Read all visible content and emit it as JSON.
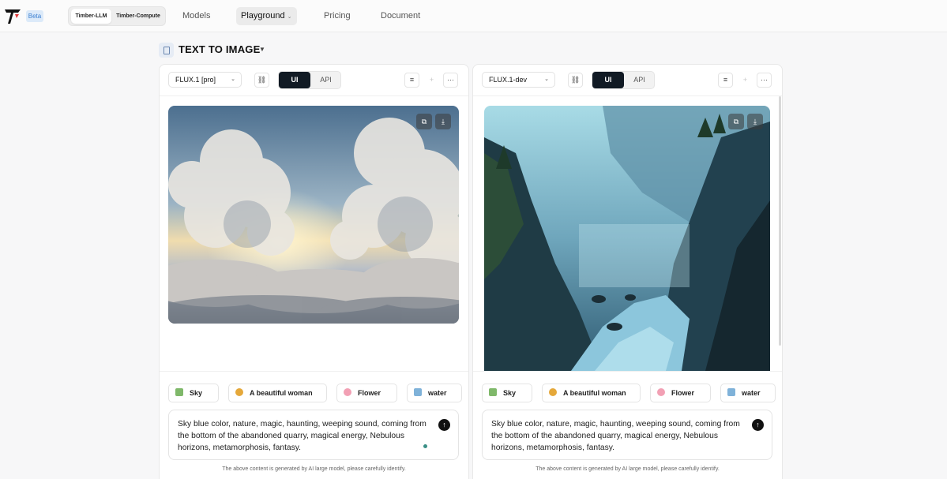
{
  "brand": {
    "beta_label": "Beta",
    "logo_icon": "timber-logo-icon"
  },
  "switcher": {
    "items": [
      "Timber-LLM",
      "Timber-Compute"
    ]
  },
  "nav": {
    "items": [
      "Models",
      "Playground",
      "Pricing",
      "Document"
    ]
  },
  "section": {
    "title": "TEXT TO IMAGE"
  },
  "panels": [
    {
      "model": "FLUX.1 [pro]",
      "mode": {
        "ui": "UI",
        "api": "API"
      },
      "image": "cloud sky above sea of clouds",
      "chips": [
        "Sky",
        "A beautiful woman",
        "Flower",
        "water"
      ],
      "prompt": "Sky blue color, nature, magic, haunting, weeping sound, coming from the bottom of the abandoned quarry, magical energy, Nebulous horizons, metamorphosis, fantasy.",
      "disclaimer": "The above content is generated by AI large model, please carefully identify."
    },
    {
      "model": "FLUX.1-dev",
      "mode": {
        "ui": "UI",
        "api": "API"
      },
      "image": "misty blue canyon river",
      "chips": [
        "Sky",
        "A beautiful woman",
        "Flower",
        "water"
      ],
      "prompt": "Sky blue color, nature, magic, haunting, weeping sound, coming from the bottom of the abandoned quarry, magical energy, Nebulous horizons, metamorphosis, fantasy.",
      "disclaimer": "The above content is generated by AI large model, please carefully identify."
    }
  ],
  "colors": {
    "accent_dark": "#111a24",
    "beta_bg": "#dceaf9",
    "beta_text": "#3b7fd1"
  }
}
